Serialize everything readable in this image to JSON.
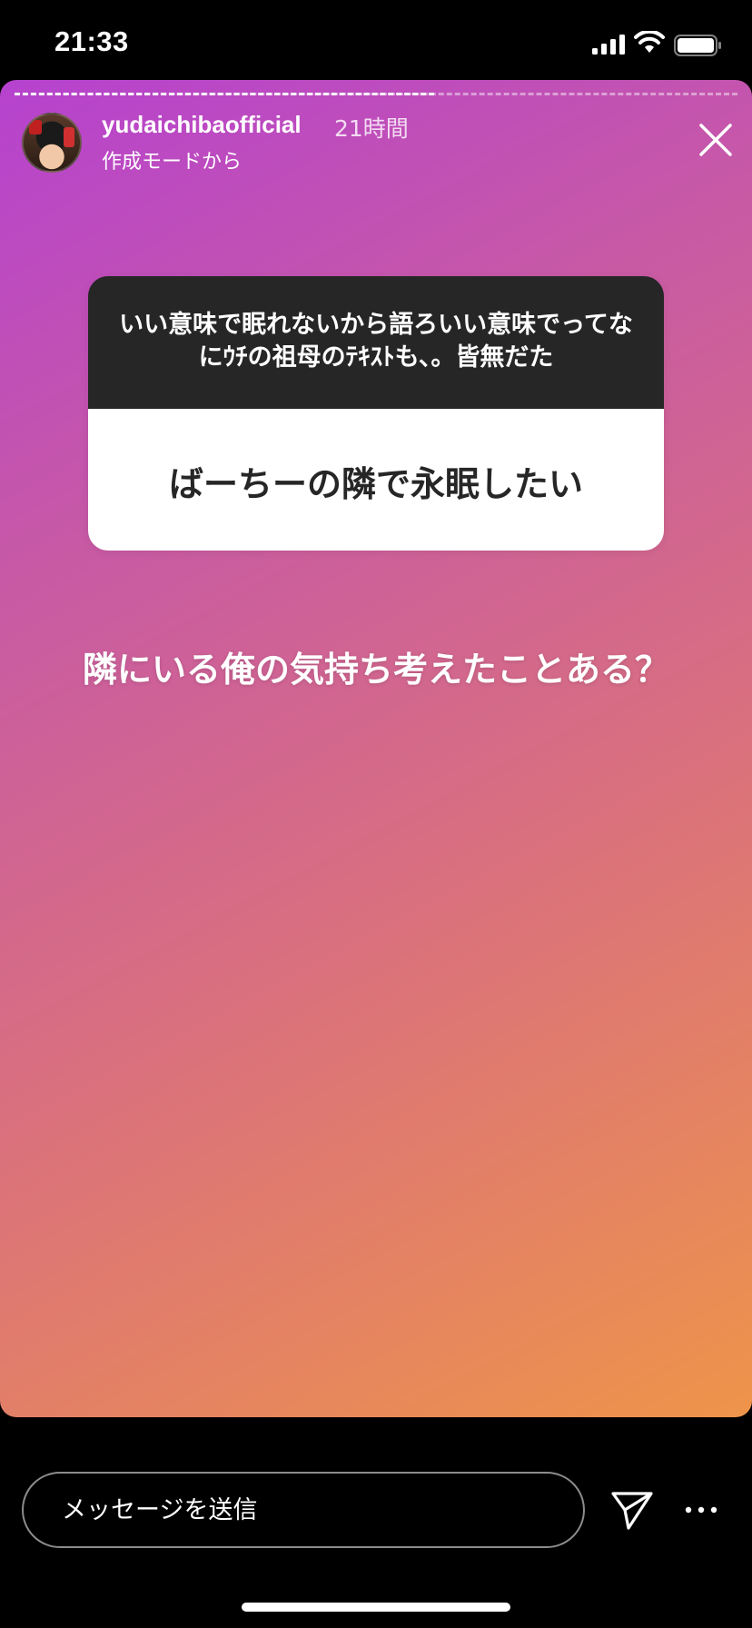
{
  "status_bar": {
    "time": "21:33"
  },
  "story": {
    "username": "yudaichibaofficial",
    "post_time": "21時間",
    "subtitle": "作成モードから",
    "progress": 0.58,
    "gradient_colors": [
      "#b642cf",
      "#c85aa4",
      "#d9707e",
      "#ee944a"
    ],
    "question_sticker": {
      "question": "いい意味で眠れないから語ろいい意味でってなにｳﾁの祖母のﾃｷｽﾄも、。皆無だた",
      "answer": "ばーちーの隣で永眠したい"
    },
    "reply_text": "隣にいる俺の気持ち考えたことある？"
  },
  "footer": {
    "message_placeholder": "メッセージを送信",
    "send_icon": "paper-plane-icon",
    "more_icon": "more-dots-icon"
  }
}
